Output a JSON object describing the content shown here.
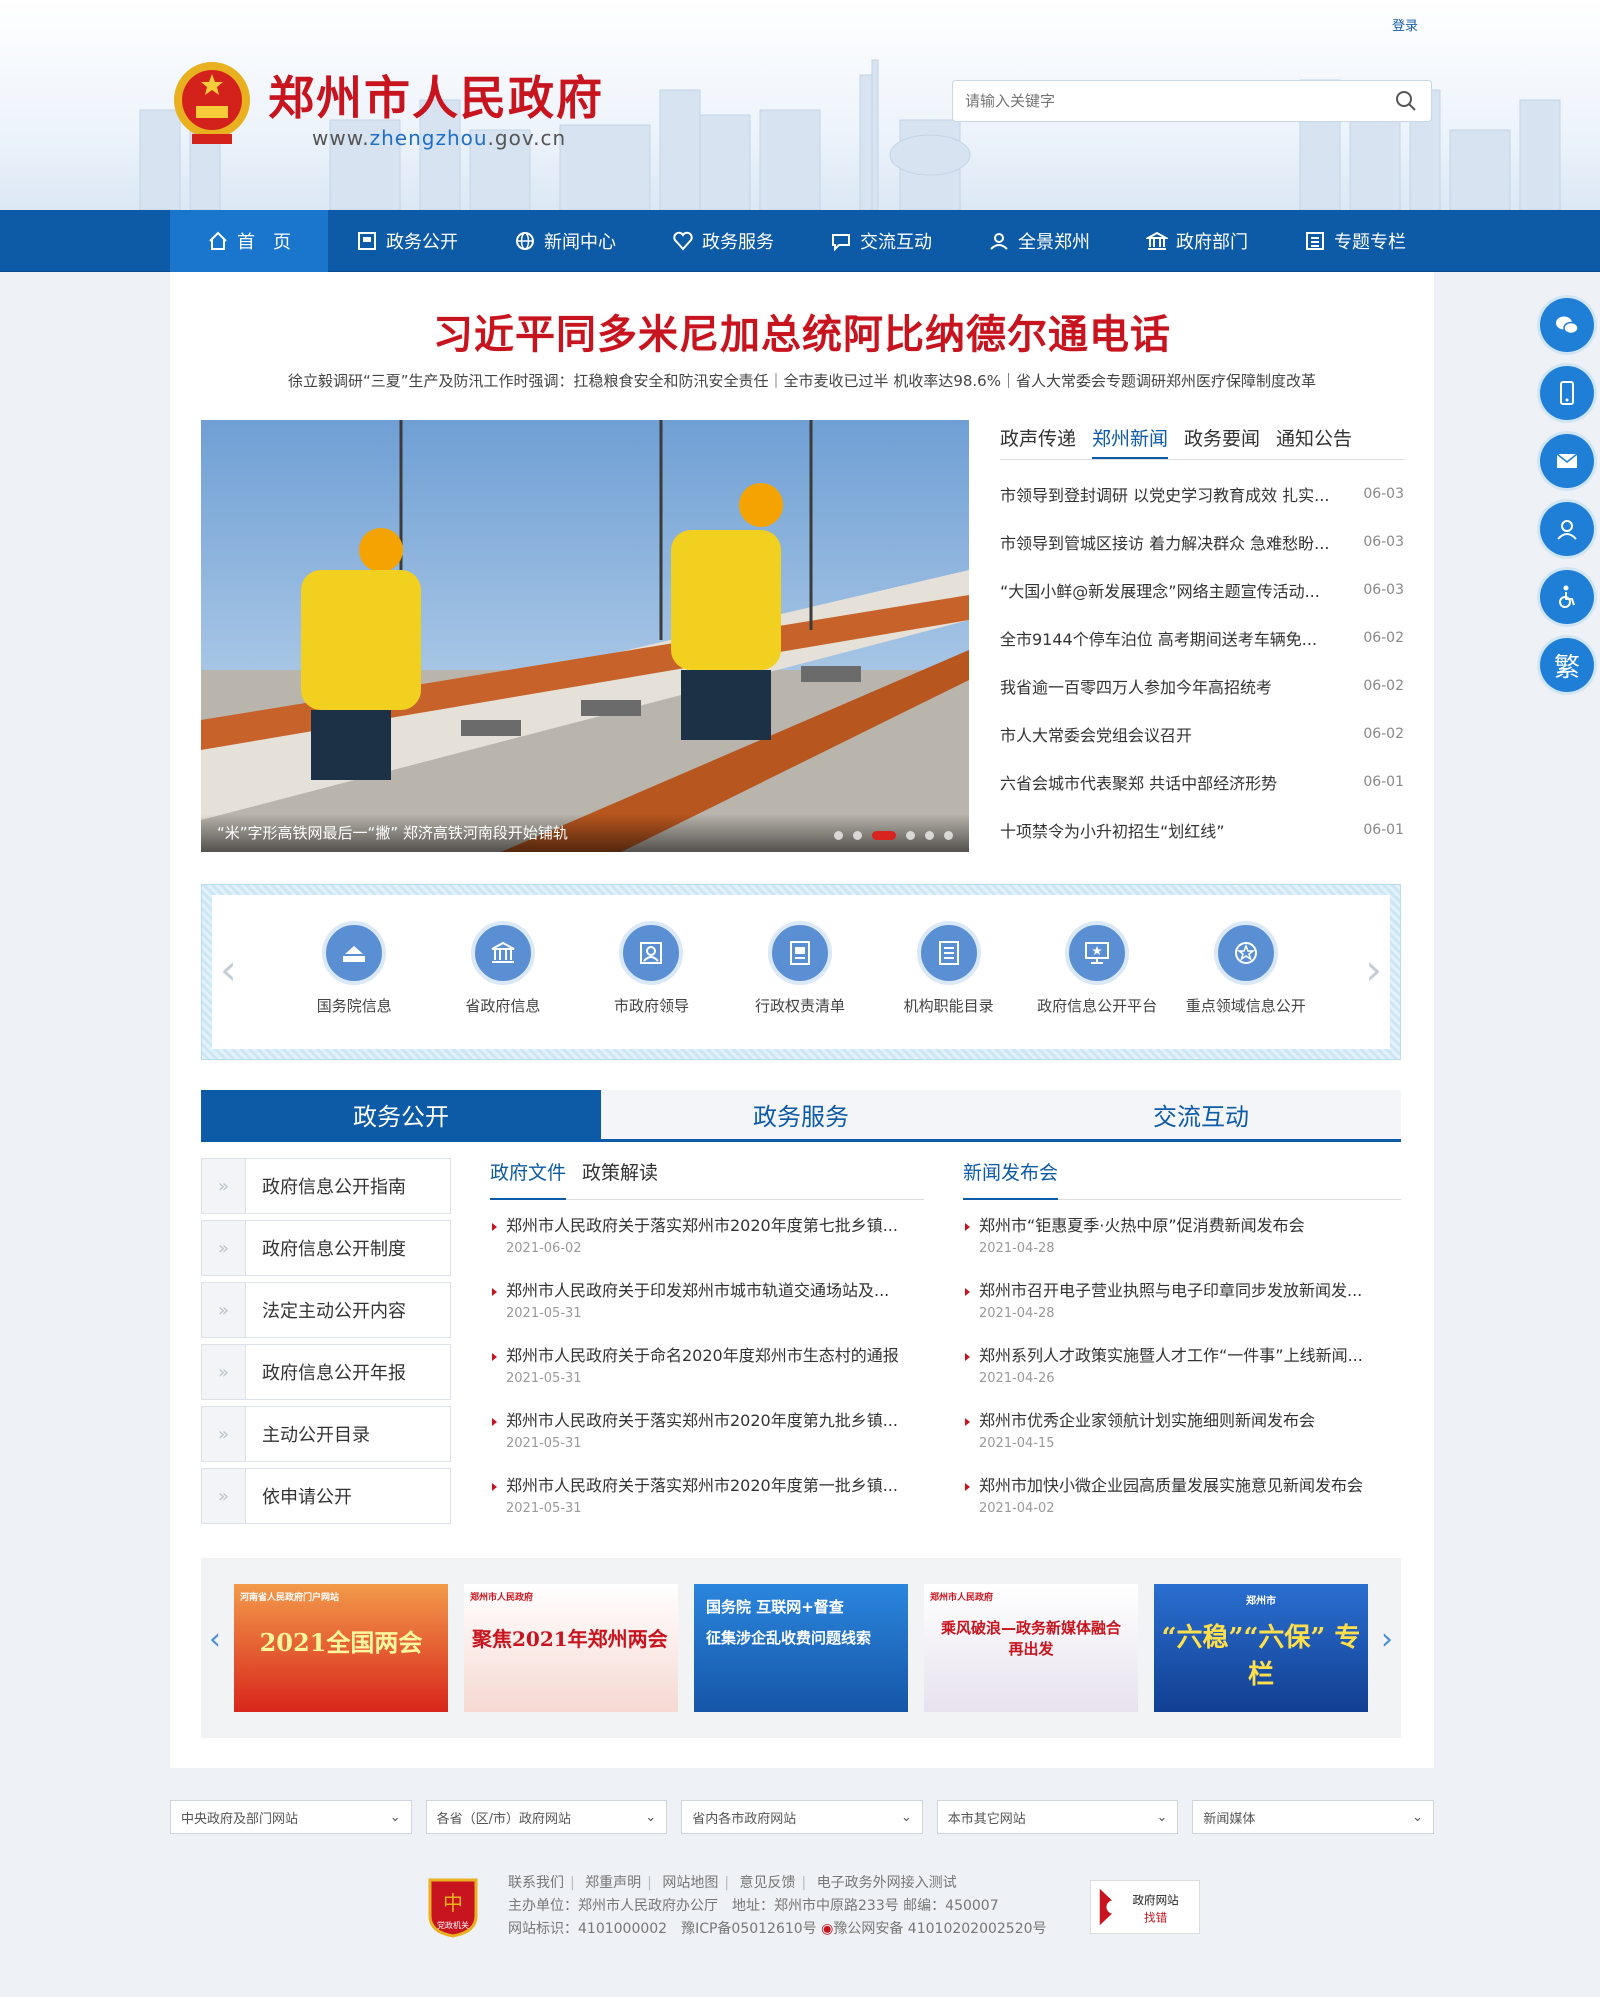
{
  "header": {
    "login": "登录",
    "title": "郑州市人民政府",
    "url_prefix": "www.",
    "url_highlight": "zhengzhou",
    "url_suffix": ".gov.cn",
    "search_placeholder": "请输入关键字"
  },
  "nav": [
    {
      "label": "首　页",
      "icon": "home-icon",
      "active": true
    },
    {
      "label": "政务公开",
      "icon": "document-icon"
    },
    {
      "label": "新闻中心",
      "icon": "globe-icon"
    },
    {
      "label": "政务服务",
      "icon": "heart-icon"
    },
    {
      "label": "交流互动",
      "icon": "chat-icon"
    },
    {
      "label": "全景郑州",
      "icon": "panorama-icon"
    },
    {
      "label": "政府部门",
      "icon": "building-icon"
    },
    {
      "label": "专题专栏",
      "icon": "list-icon"
    }
  ],
  "headline": "习近平同多米尼加总统阿比纳德尔通电话",
  "subline": "徐立毅调研“三夏”生产及防汛工作时强调：扛稳粮食安全和防汛安全责任｜全市麦收已过半 机收率达98.6%｜省人大常委会专题调研郑州医疗保障制度改革",
  "carousel": {
    "caption": "“米”字形高铁网最后一“撇” 郑济高铁河南段开始铺轨",
    "dot_count": 6,
    "active_dot": 2
  },
  "news": {
    "tabs": [
      "政声传递",
      "郑州新闻",
      "政务要闻",
      "通知公告"
    ],
    "active_tab": 1,
    "items": [
      {
        "title": "市领导到登封调研 以党史学习教育成效 扎实...",
        "date": "06-03"
      },
      {
        "title": "市领导到管城区接访 着力解决群众 急难愁盼...",
        "date": "06-03"
      },
      {
        "title": "“大国小鲜@新发展理念”网络主题宣传活动...",
        "date": "06-03"
      },
      {
        "title": "全市9144个停车泊位 高考期间送考车辆免...",
        "date": "06-02"
      },
      {
        "title": "我省逾一百零四万人参加今年高招统考",
        "date": "06-02"
      },
      {
        "title": "市人大常委会党组会议召开",
        "date": "06-02"
      },
      {
        "title": "六省会城市代表聚郑 共话中部经济形势",
        "date": "06-01"
      },
      {
        "title": "十项禁令为小升初招生“划红线”",
        "date": "06-01"
      }
    ]
  },
  "quick_links": [
    {
      "label": "国务院信息",
      "icon": "state-council-icon"
    },
    {
      "label": "省政府信息",
      "icon": "government-building-icon"
    },
    {
      "label": "市政府领导",
      "icon": "leader-icon"
    },
    {
      "label": "行政权责清单",
      "icon": "checklist-icon"
    },
    {
      "label": "机构职能目录",
      "icon": "catalog-icon"
    },
    {
      "label": "政府信息公开平台",
      "icon": "monitor-icon"
    },
    {
      "label": "重点领域信息公开",
      "icon": "star-icon"
    }
  ],
  "section_tabs": [
    "政务公开",
    "政务服务",
    "交流互动"
  ],
  "side_menu": [
    "政府信息公开指南",
    "政府信息公开制度",
    "法定主动公开内容",
    "政府信息公开年报",
    "主动公开目录",
    "依申请公开"
  ],
  "policy": {
    "tabs": [
      "政府文件",
      "政策解读"
    ],
    "items": [
      {
        "title": "郑州市人民政府关于落实郑州市2020年度第七批乡镇...",
        "date": "2021-06-02"
      },
      {
        "title": "郑州市人民政府关于印发郑州市城市轨道交通场站及...",
        "date": "2021-05-31"
      },
      {
        "title": "郑州市人民政府关于命名2020年度郑州市生态村的通报",
        "date": "2021-05-31"
      },
      {
        "title": "郑州市人民政府关于落实郑州市2020年度第九批乡镇...",
        "date": "2021-05-31"
      },
      {
        "title": "郑州市人民政府关于落实郑州市2020年度第一批乡镇...",
        "date": "2021-05-31"
      }
    ]
  },
  "press": {
    "tabs": [
      "新闻发布会"
    ],
    "items": [
      {
        "title": "郑州市“钜惠夏季·火热中原”促消费新闻发布会",
        "date": "2021-04-28"
      },
      {
        "title": "郑州市召开电子营业执照与电子印章同步发放新闻发...",
        "date": "2021-04-28"
      },
      {
        "title": "郑州系列人才政策实施暨人才工作“一件事”上线新闻...",
        "date": "2021-04-26"
      },
      {
        "title": "郑州市优秀企业家领航计划实施细则新闻发布会",
        "date": "2021-04-15"
      },
      {
        "title": "郑州市加快小微企业园高质量发展实施意见新闻发布会",
        "date": "2021-04-02"
      }
    ]
  },
  "banners": [
    {
      "top": "河南省人民政府门户网站",
      "main": "2021全国两会",
      "bg": "#d8261c"
    },
    {
      "top": "郑州市人民政府",
      "main": "聚焦2021年郑州两会",
      "bg": "#f7efe9"
    },
    {
      "top": "国务院 互联网+督查",
      "main": "征集涉企乱收费问题线索",
      "bg": "#1f72c9"
    },
    {
      "top": "郑州市人民政府",
      "main": "乘风破浪—政务新媒体融合 再出发",
      "bg": "#f3f0f4"
    },
    {
      "top": "郑州市",
      "main": "“六稳”“六保” 专栏",
      "bg": "#1a56b8"
    }
  ],
  "footer": {
    "selects": [
      "中央政府及部门网站",
      "各省（区/市）政府网站",
      "省内各市政府网站",
      "本市其它网站",
      "新闻媒体"
    ],
    "links": [
      "联系我们",
      "郑重声明",
      "网站地图",
      "意见反馈",
      "电子政务外网接入测试"
    ],
    "host": "主办单位：郑州市人民政府办公厅　地址：郑州市中原路233号 邮编：450007",
    "ids": "网站标识：4101000002　豫ICP备05012610号",
    "police": "豫公网安备 41010202002520号",
    "badge_left": "党政机关",
    "badge_right_top": "政府网站",
    "badge_right_bottom": "找错"
  },
  "float_buttons": [
    "wechat-icon",
    "mobile-icon",
    "mail-icon",
    "service-icon",
    "accessibility-icon",
    "繁"
  ]
}
